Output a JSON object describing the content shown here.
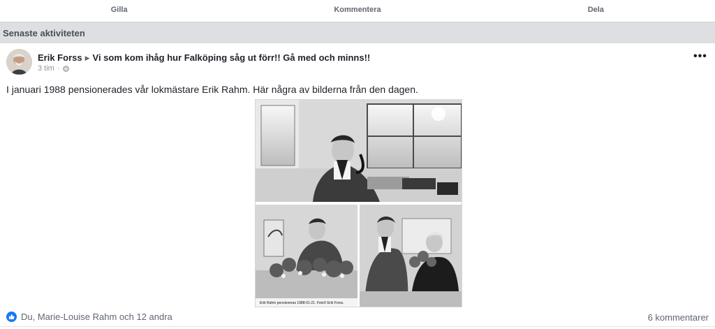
{
  "actions": {
    "like": "Gilla",
    "comment": "Kommentera",
    "share": "Dela"
  },
  "section": {
    "title": "Senaste aktiviteten"
  },
  "post": {
    "author": "Erik Forss",
    "group": "Vi som kom ihåg hur Falköping såg ut förr!! Gå med och minns!!",
    "time": "3 tim",
    "text": "I januari 1988 pensionerades vår lokmästare Erik Rahm. Här några av bilderna från den dagen.",
    "photo_caption": "Erik Rahm pensioneras 1988-01-21. Foto© Erik Forss.",
    "reactions": "Du, Marie-Louise Rahm och 12 andra",
    "comments": "6 kommentarer"
  },
  "icons": {
    "privacy": "globe-icon",
    "like": "like-icon",
    "more": "more-icon"
  },
  "colors": {
    "accent": "#1877f2",
    "section_bg": "#dddfe2",
    "muted_text": "#606770"
  }
}
